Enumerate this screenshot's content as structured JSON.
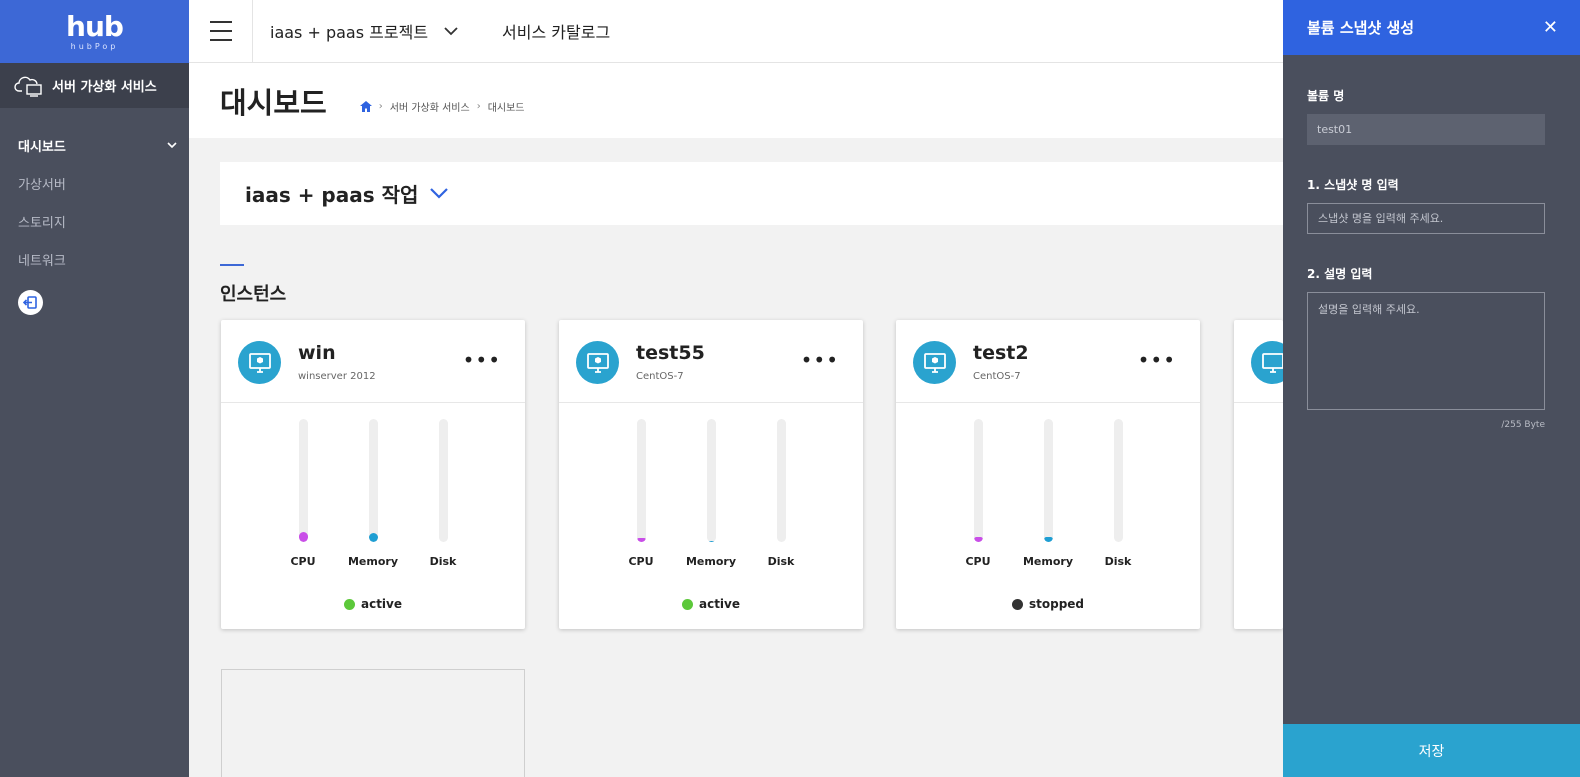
{
  "logo": {
    "main": "hub",
    "sub": "hubPop"
  },
  "sidebar": {
    "service_title": "서버 가상화 서비스",
    "items": [
      {
        "label": "대시보드",
        "active": true
      },
      {
        "label": "가상서버",
        "active": false
      },
      {
        "label": "스토리지",
        "active": false
      },
      {
        "label": "네트워크",
        "active": false
      }
    ]
  },
  "header": {
    "project": "iaas + paas 프로젝트",
    "catalog": "서비스 카탈로그"
  },
  "page": {
    "title": "대시보드",
    "breadcrumb": [
      "서버 가상화 서비스",
      "대시보드"
    ]
  },
  "work": {
    "title": "iaas + paas 작업"
  },
  "section": {
    "title": "인스턴스"
  },
  "instances": [
    {
      "name": "win",
      "os": "winserver 2012",
      "status": "active",
      "status_color": "#5cc83a",
      "gauges": [
        {
          "label": "CPU",
          "value": 0.08,
          "color": "#c94ee8"
        },
        {
          "label": "Memory",
          "value": 0.07,
          "color": "#1e9ed3"
        },
        {
          "label": "Disk",
          "value": 0,
          "color": "#999999"
        }
      ]
    },
    {
      "name": "test55",
      "os": "CentOS-7",
      "status": "active",
      "status_color": "#5cc83a",
      "gauges": [
        {
          "label": "CPU",
          "value": 0.03,
          "color": "#c94ee8"
        },
        {
          "label": "Memory",
          "value": 0.01,
          "color": "#1e9ed3"
        },
        {
          "label": "Disk",
          "value": 0,
          "color": "#999999"
        }
      ]
    },
    {
      "name": "test2",
      "os": "CentOS-7",
      "status": "stopped",
      "status_color": "#333333",
      "gauges": [
        {
          "label": "CPU",
          "value": 0.04,
          "color": "#c94ee8"
        },
        {
          "label": "Memory",
          "value": 0.04,
          "color": "#1e9ed3"
        },
        {
          "label": "Disk",
          "value": 0,
          "color": "#999999"
        }
      ]
    }
  ],
  "panel": {
    "title": "볼륨 스냅샷 생성",
    "volume_label": "볼륨 명",
    "volume_value": "test01",
    "snapshot_label": "1. 스냅샷 명 입력",
    "snapshot_placeholder": "스냅샷 명을 입력해 주세요.",
    "desc_label": "2. 설명 입력",
    "desc_placeholder": "설명을 입력해 주세요.",
    "byte_count": "/255 Byte",
    "save": "저장"
  }
}
